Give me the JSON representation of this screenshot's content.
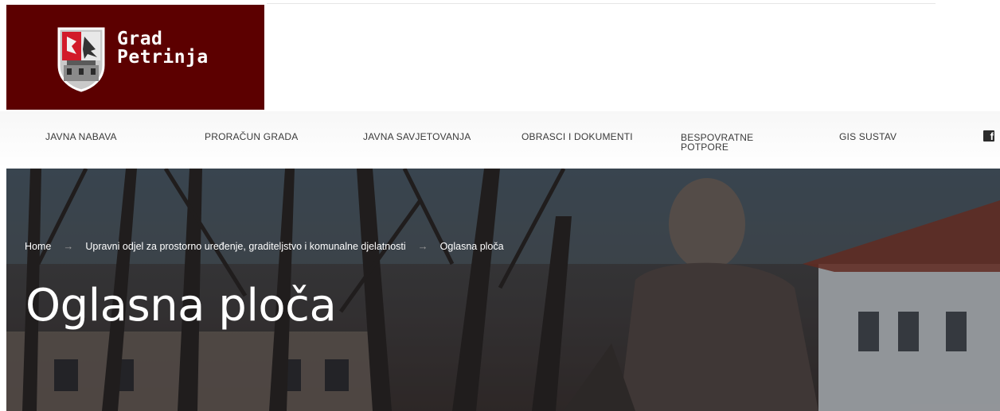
{
  "brand": {
    "line1": "Grad",
    "line2": "Petrinja",
    "color": "#5c0000"
  },
  "nav": {
    "items": [
      {
        "label": "JAVNA NABAVA"
      },
      {
        "label": "PRORAČUN GRADA"
      },
      {
        "label": "JAVNA SAVJETOVANJA"
      },
      {
        "label": "OBRASCI I DOKUMENTI"
      },
      {
        "label": "BESPOVRATNE POTPORE"
      },
      {
        "label": "GIS SUSTAV"
      }
    ],
    "social_icon": "facebook-icon"
  },
  "breadcrumb": {
    "items": [
      {
        "label": "Home"
      },
      {
        "label": "Upravni odjel za prostorno uređenje, graditeljstvo i komunalne djelatnosti"
      },
      {
        "label": "Oglasna ploča"
      }
    ],
    "separator": "→"
  },
  "page": {
    "title": "Oglasna ploča"
  }
}
